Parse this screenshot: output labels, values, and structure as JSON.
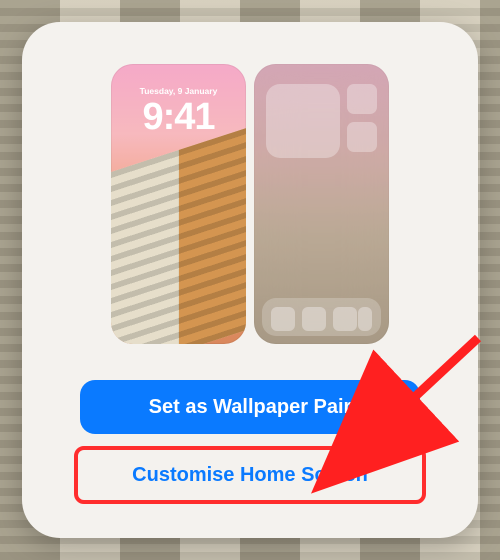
{
  "lock_preview": {
    "date": "Tuesday, 9 January",
    "time": "9:41"
  },
  "buttons": {
    "set_pair_label": "Set as Wallpaper Pair",
    "customise_label": "Customise Home Screen"
  },
  "annotations": {
    "arrow_color": "#ff2020",
    "highlight_color": "#ff2d2d"
  }
}
